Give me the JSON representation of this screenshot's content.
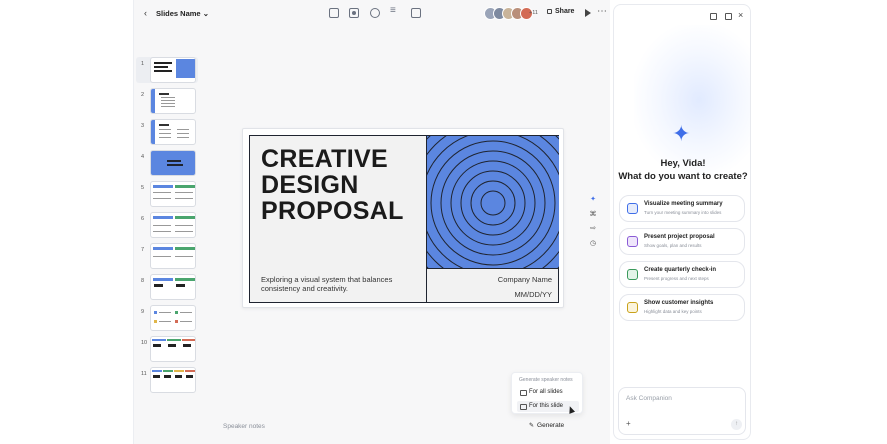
{
  "topbar": {
    "doc_name": "Slides Name",
    "avatar_overflow": "+11",
    "share_label": "Share",
    "avatars": [
      "#9aa4b8",
      "#7e8aa0",
      "#c9b49a",
      "#b98f7a",
      "#d36b55"
    ]
  },
  "thumbnails": [
    {
      "num": "1"
    },
    {
      "num": "2"
    },
    {
      "num": "3"
    },
    {
      "num": "4"
    },
    {
      "num": "5"
    },
    {
      "num": "6"
    },
    {
      "num": "7"
    },
    {
      "num": "8"
    },
    {
      "num": "9"
    },
    {
      "num": "10"
    },
    {
      "num": "11"
    }
  ],
  "slide": {
    "title_line1": "CREATIVE",
    "title_line2": "DESIGN",
    "title_line3": "PROPOSAL",
    "description": "Exploring a visual system that balances consistency and creativity.",
    "company": "Company Name",
    "date": "MM/DD/YY"
  },
  "notes": {
    "placeholder": "Speaker notes",
    "generate_label": "Generate"
  },
  "generate_menu": {
    "header": "Generate speaker notes",
    "for_all": "For all slides",
    "for_this": "For this slide"
  },
  "companion": {
    "greeting": "Hey, Vida!",
    "question": "What do you want to create?",
    "suggestions": [
      {
        "title": "Visualize meeting summary",
        "subtitle": "Turn your meeting summary into slides",
        "icon": "slides-icon",
        "color": "#e6ecfb",
        "stroke": "#3f6ee8"
      },
      {
        "title": "Present project proposal",
        "subtitle": "Show goals, plan and results",
        "icon": "grid-icon",
        "color": "#efe6fb",
        "stroke": "#8a5bd6"
      },
      {
        "title": "Create quarterly check-in",
        "subtitle": "Present progress and next steps",
        "icon": "chart-icon",
        "color": "#e3f4e8",
        "stroke": "#3a9a5b"
      },
      {
        "title": "Show customer insights",
        "subtitle": "Highlight data and key points",
        "icon": "bulb-icon",
        "color": "#fbf4dc",
        "stroke": "#c9a21a"
      }
    ],
    "ask_placeholder": "Ask Companion"
  },
  "colors": {
    "slide_art": "#5b86e0",
    "accent": "#3f6ee8"
  }
}
